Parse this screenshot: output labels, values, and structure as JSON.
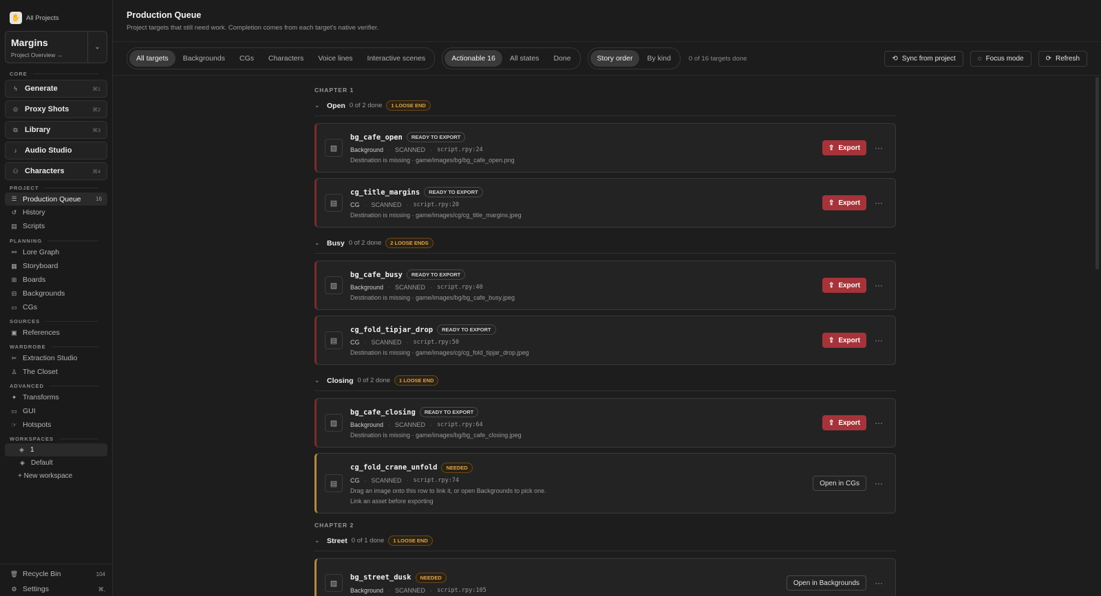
{
  "sidebar": {
    "all_projects": "All Projects",
    "project_name": "Margins",
    "project_sub": "Project Overview →",
    "sections": {
      "core": "CORE",
      "project": "PROJECT",
      "planning": "PLANNING",
      "sources": "SOURCES",
      "wardrobe": "WARDROBE",
      "advanced": "ADVANCED",
      "workspaces": "WORKSPACES"
    },
    "core": [
      {
        "label": "Generate",
        "key": "⌘1",
        "icon": "bolt-icon"
      },
      {
        "label": "Proxy Shots",
        "key": "⌘2",
        "icon": "pin-icon"
      },
      {
        "label": "Library",
        "key": "⌘3",
        "icon": "library-icon"
      },
      {
        "label": "Audio Studio",
        "key": "",
        "icon": "music-icon"
      },
      {
        "label": "Characters",
        "key": "⌘4",
        "icon": "people-icon"
      }
    ],
    "project": [
      {
        "label": "Production Queue",
        "count": "16"
      },
      {
        "label": "History",
        "count": ""
      },
      {
        "label": "Scripts",
        "count": ""
      }
    ],
    "planning": [
      "Lore Graph",
      "Storyboard",
      "Boards",
      "Backgrounds",
      "CGs"
    ],
    "sources": [
      "References"
    ],
    "wardrobe": [
      "Extraction Studio",
      "The Closet"
    ],
    "advanced": [
      "Transforms",
      "GUI",
      "Hotspots"
    ],
    "workspaces": {
      "active": "1",
      "default": "Default",
      "new": "+ New workspace"
    },
    "recycle": {
      "label": "Recycle Bin",
      "count": "104"
    },
    "settings": {
      "label": "Settings",
      "key": "⌘,"
    }
  },
  "header": {
    "title": "Production Queue",
    "subtitle": "Project targets that still need work. Completion comes from each target's native verifier."
  },
  "toolbar": {
    "kinds": [
      "All targets",
      "Backgrounds",
      "CGs",
      "Characters",
      "Voice lines",
      "Interactive scenes"
    ],
    "states": [
      "Actionable 16",
      "All states",
      "Done"
    ],
    "order": [
      "Story order",
      "By kind"
    ],
    "progress": "0 of 16 targets done",
    "sync": "Sync from project",
    "focus": "Focus mode",
    "refresh": "Refresh"
  },
  "queue": {
    "ch1": "CHAPTER 1",
    "ch2": "CHAPTER 2",
    "groups": [
      {
        "name": "Open",
        "done": "0 of 2 done",
        "loose": "1 LOOSE END"
      },
      {
        "name": "Busy",
        "done": "0 of 2 done",
        "loose": "2 LOOSE ENDS"
      },
      {
        "name": "Closing",
        "done": "0 of 2 done",
        "loose": "1 LOOSE END"
      },
      {
        "name": "Street",
        "done": "0 of 1 done",
        "loose": "1 LOOSE END"
      }
    ],
    "cards": [
      {
        "name": "bg_cafe_open",
        "badge": "READY TO EXPORT",
        "kind": "Background",
        "status": "SCANNED",
        "line": "script.rpy:24",
        "note": "Destination is missing · game/images/bg/bg_cafe_open.png",
        "action": "Export"
      },
      {
        "name": "cg_title_margins",
        "badge": "READY TO EXPORT",
        "kind": "CG",
        "status": "SCANNED",
        "line": "script.rpy:20",
        "note": "Destination is missing · game/images/cg/cg_title_margins.jpeg",
        "action": "Export"
      },
      {
        "name": "bg_cafe_busy",
        "badge": "READY TO EXPORT",
        "kind": "Background",
        "status": "SCANNED",
        "line": "script.rpy:40",
        "note": "Destination is missing · game/images/bg/bg_cafe_busy.jpeg",
        "action": "Export"
      },
      {
        "name": "cg_fold_tipjar_drop",
        "badge": "READY TO EXPORT",
        "kind": "CG",
        "status": "SCANNED",
        "line": "script.rpy:50",
        "note": "Destination is missing · game/images/cg/cg_fold_tipjar_drop.jpeg",
        "action": "Export"
      },
      {
        "name": "bg_cafe_closing",
        "badge": "READY TO EXPORT",
        "kind": "Background",
        "status": "SCANNED",
        "line": "script.rpy:64",
        "note": "Destination is missing · game/images/bg/bg_cafe_closing.jpeg",
        "action": "Export"
      },
      {
        "name": "cg_fold_crane_unfold",
        "badge": "NEEDED",
        "kind": "CG",
        "status": "SCANNED",
        "line": "script.rpy:74",
        "note": "Drag an image onto this row to link it, or open Backgrounds to pick one.",
        "note2": "Link an asset before exporting",
        "action": "Open in CGs"
      },
      {
        "name": "bg_street_dusk",
        "badge": "NEEDED",
        "kind": "Background",
        "status": "SCANNED",
        "line": "script.rpy:105",
        "action": "Open in Backgrounds"
      }
    ]
  },
  "colors": {
    "accent": "#a7333a",
    "warning": "#e0a44a",
    "bg": "#1c1c1c"
  }
}
